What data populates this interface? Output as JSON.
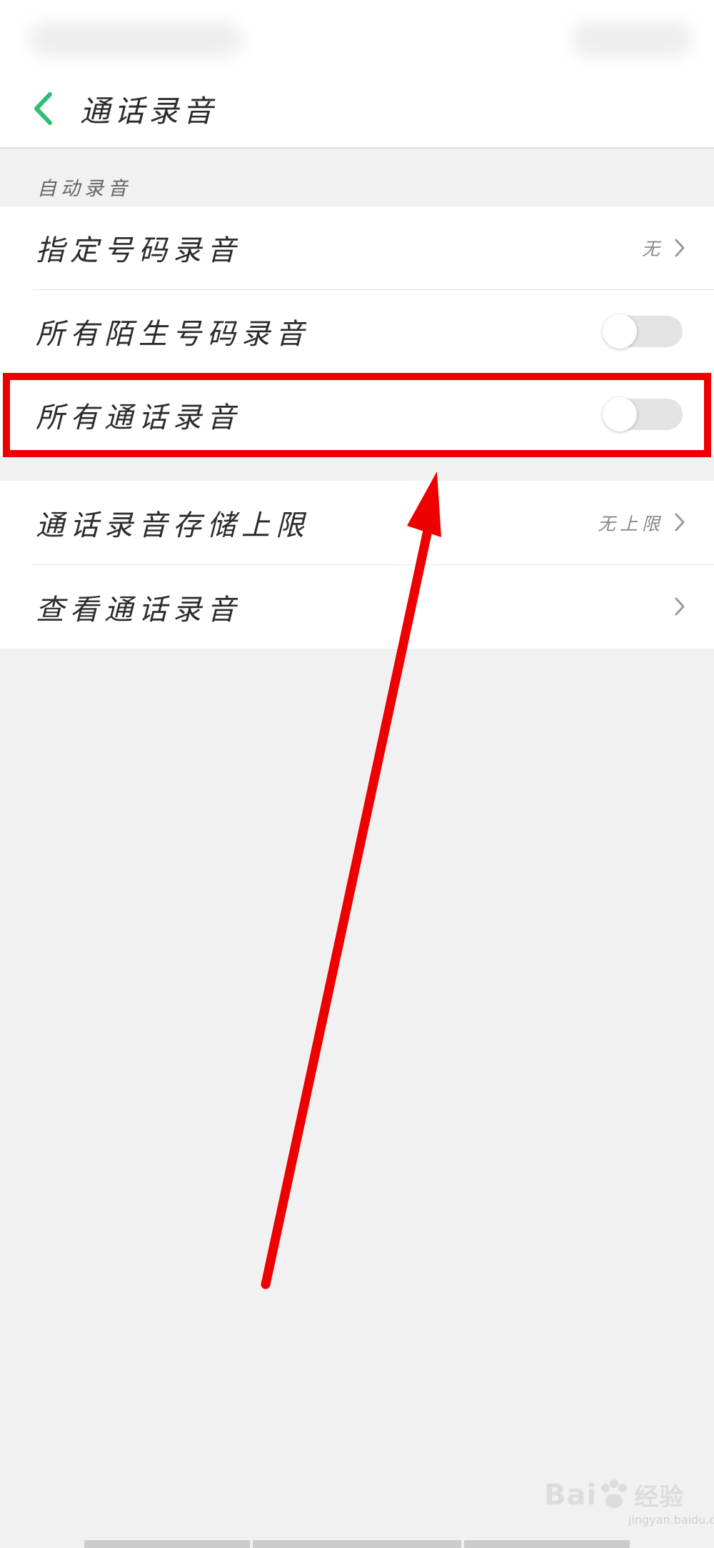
{
  "header": {
    "title": "通话录音"
  },
  "section": {
    "label": "自动录音"
  },
  "items": [
    {
      "label": "指定号码录音",
      "value": "无"
    },
    {
      "label": "所有陌生号码录音",
      "toggle": false
    },
    {
      "label": "所有通话录音",
      "toggle": false
    },
    {
      "label": "通话录音存储上限",
      "value": "无上限"
    },
    {
      "label": "查看通话录音"
    }
  ],
  "icons": {
    "back": "chevron-left-icon",
    "chevron": "chevron-right-icon"
  },
  "colors": {
    "accent": "#2fbf71",
    "highlight": "#ee0000"
  },
  "watermark": {
    "brand": "Bai",
    "brand2": "经验",
    "url": "jingyan.baidu.com"
  }
}
